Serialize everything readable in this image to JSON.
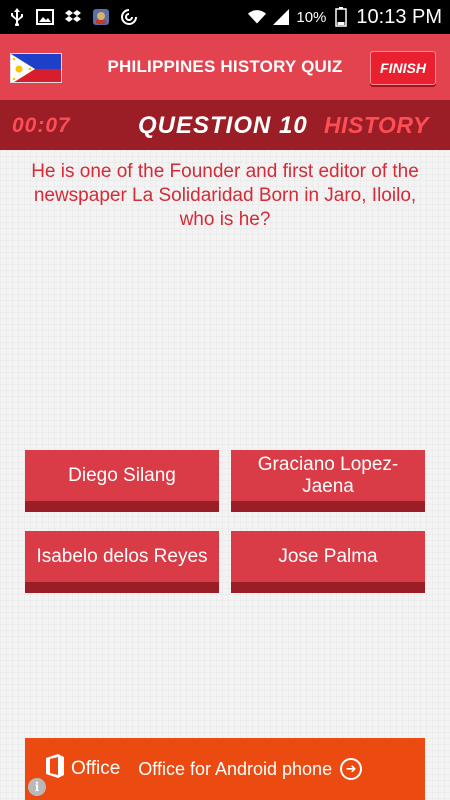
{
  "status_bar": {
    "battery_percent": "10%",
    "time": "10:13 PM",
    "icons": [
      "usb-icon",
      "image-icon",
      "dropbox-icon",
      "app-icon",
      "sync-icon",
      "wifi-icon",
      "signal-icon",
      "battery-icon"
    ]
  },
  "header": {
    "title": "PHILIPPINES HISTORY QUIZ",
    "finish_label": "FINISH",
    "flag_icon": "philippines-flag-icon"
  },
  "quiz": {
    "timer": "00:07",
    "question_number": "QUESTION 10",
    "category": "HISTORY",
    "question": "He is one of the Founder and first editor of the newspaper La Solidaridad Born in Jaro, Iloilo, who is he?",
    "answers": [
      "Diego Silang",
      "Graciano Lopez-Jaena",
      "Isabelo delos Reyes",
      "Jose Palma"
    ]
  },
  "ad": {
    "logo_text": "Office",
    "text": "Office for Android phone",
    "info_icon": "info-icon"
  },
  "colors": {
    "header_red": "#e2434f",
    "strip_dark_red": "#9b1d25",
    "answer_red": "#d93c47",
    "question_text": "#d62a36",
    "ad_orange": "#eb4a10"
  }
}
